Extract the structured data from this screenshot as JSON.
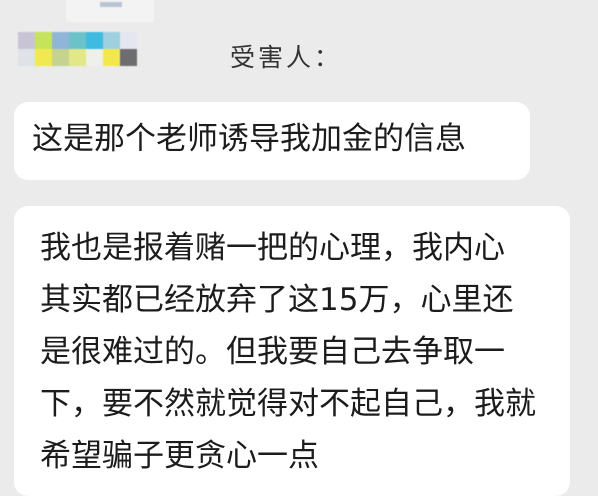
{
  "chat": {
    "sender_name": "受害人：",
    "messages": [
      {
        "lines": [
          "这是那个老师诱导我加金的信息"
        ]
      },
      {
        "lines": [
          "我也是报着赌一把的心理，我内心",
          "其实都已经放弃了这15万，心里还",
          "是很难过的。但我要自己去争取一",
          "下，要不然就觉得对不起自己，我就",
          "希望骗子更贪心一点"
        ]
      }
    ]
  },
  "avatar": {
    "pixel_colors": [
      [
        "#c9c3d6",
        "#c7e25b",
        "#8fb5d7",
        "#6bc3c9",
        "#3dbbe0",
        "#9fd0df",
        "#e4e7ef"
      ],
      [
        "#dfe3e8",
        "#f0e950",
        "#c4d38f",
        "#e2e887",
        "#eef0ea",
        "#f3e84b",
        "#6d6d6f"
      ]
    ]
  }
}
